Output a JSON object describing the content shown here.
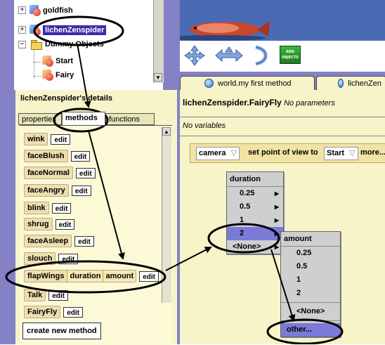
{
  "tree": {
    "items": [
      {
        "label": "goldfish",
        "expander": "+"
      },
      {
        "label": "lichenZenspider",
        "expander": "+"
      },
      {
        "label": "Dummy Objects",
        "expander": "−"
      },
      {
        "label": "Start"
      },
      {
        "label": "Fairy"
      }
    ]
  },
  "controls": {
    "add_objects": "ADD OBJECTS"
  },
  "details": {
    "title": "lichenZenspider's details",
    "tabs": [
      "properties",
      "methods",
      "functions"
    ],
    "methods": [
      {
        "name": "wink",
        "edit": "edit"
      },
      {
        "name": "faceBlush",
        "edit": "edit"
      },
      {
        "name": "faceNormal",
        "edit": "edit"
      },
      {
        "name": "faceAngry",
        "edit": "edit"
      },
      {
        "name": "blink",
        "edit": "edit"
      },
      {
        "name": "shrug",
        "edit": "edit"
      },
      {
        "name": "faceAsleep",
        "edit": "edit"
      },
      {
        "name": "slouch",
        "edit": "edit"
      },
      {
        "name": "flapWings",
        "params": [
          "duration",
          "amount"
        ],
        "edit": "edit"
      },
      {
        "name": "Talk",
        "edit": "edit"
      },
      {
        "name": "FairyFly",
        "edit": "edit"
      }
    ],
    "create_button": "create new method"
  },
  "editor": {
    "tabs": [
      "world.my first method",
      "lichenZen"
    ],
    "method_object": "lichenZenspider.FairyFly",
    "params_note": "No parameters",
    "vars_note": "No variables",
    "statement": {
      "object": "camera",
      "dropdown": "▽",
      "action": "set point of view to",
      "target": "Start",
      "target_dropdown": "▽",
      "more": "more..."
    }
  },
  "menu_duration": {
    "title": "duration",
    "items": [
      "0.25",
      "0.5",
      "1",
      "2",
      "<None>"
    ],
    "selected": "2"
  },
  "menu_amount": {
    "title": "amount",
    "items": [
      "0.25",
      "0.5",
      "1",
      "2",
      "<None>",
      "other..."
    ],
    "selected": "other..."
  }
}
